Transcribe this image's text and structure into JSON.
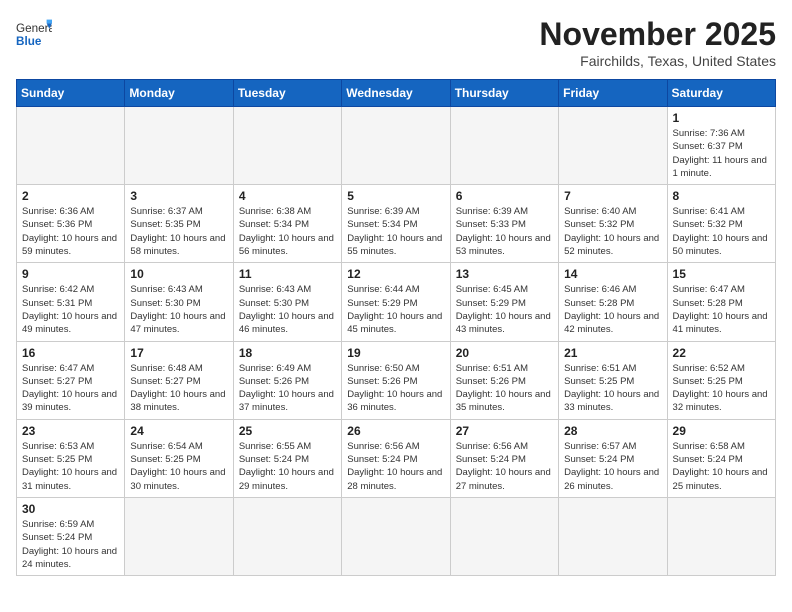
{
  "header": {
    "logo_general": "General",
    "logo_blue": "Blue",
    "month_title": "November 2025",
    "location": "Fairchilds, Texas, United States"
  },
  "days_of_week": [
    "Sunday",
    "Monday",
    "Tuesday",
    "Wednesday",
    "Thursday",
    "Friday",
    "Saturday"
  ],
  "weeks": [
    [
      {
        "day": "",
        "info": ""
      },
      {
        "day": "",
        "info": ""
      },
      {
        "day": "",
        "info": ""
      },
      {
        "day": "",
        "info": ""
      },
      {
        "day": "",
        "info": ""
      },
      {
        "day": "",
        "info": ""
      },
      {
        "day": "1",
        "info": "Sunrise: 7:36 AM\nSunset: 6:37 PM\nDaylight: 11 hours and 1 minute."
      }
    ],
    [
      {
        "day": "2",
        "info": "Sunrise: 6:36 AM\nSunset: 5:36 PM\nDaylight: 10 hours and 59 minutes."
      },
      {
        "day": "3",
        "info": "Sunrise: 6:37 AM\nSunset: 5:35 PM\nDaylight: 10 hours and 58 minutes."
      },
      {
        "day": "4",
        "info": "Sunrise: 6:38 AM\nSunset: 5:34 PM\nDaylight: 10 hours and 56 minutes."
      },
      {
        "day": "5",
        "info": "Sunrise: 6:39 AM\nSunset: 5:34 PM\nDaylight: 10 hours and 55 minutes."
      },
      {
        "day": "6",
        "info": "Sunrise: 6:39 AM\nSunset: 5:33 PM\nDaylight: 10 hours and 53 minutes."
      },
      {
        "day": "7",
        "info": "Sunrise: 6:40 AM\nSunset: 5:32 PM\nDaylight: 10 hours and 52 minutes."
      },
      {
        "day": "8",
        "info": "Sunrise: 6:41 AM\nSunset: 5:32 PM\nDaylight: 10 hours and 50 minutes."
      }
    ],
    [
      {
        "day": "9",
        "info": "Sunrise: 6:42 AM\nSunset: 5:31 PM\nDaylight: 10 hours and 49 minutes."
      },
      {
        "day": "10",
        "info": "Sunrise: 6:43 AM\nSunset: 5:30 PM\nDaylight: 10 hours and 47 minutes."
      },
      {
        "day": "11",
        "info": "Sunrise: 6:43 AM\nSunset: 5:30 PM\nDaylight: 10 hours and 46 minutes."
      },
      {
        "day": "12",
        "info": "Sunrise: 6:44 AM\nSunset: 5:29 PM\nDaylight: 10 hours and 45 minutes."
      },
      {
        "day": "13",
        "info": "Sunrise: 6:45 AM\nSunset: 5:29 PM\nDaylight: 10 hours and 43 minutes."
      },
      {
        "day": "14",
        "info": "Sunrise: 6:46 AM\nSunset: 5:28 PM\nDaylight: 10 hours and 42 minutes."
      },
      {
        "day": "15",
        "info": "Sunrise: 6:47 AM\nSunset: 5:28 PM\nDaylight: 10 hours and 41 minutes."
      }
    ],
    [
      {
        "day": "16",
        "info": "Sunrise: 6:47 AM\nSunset: 5:27 PM\nDaylight: 10 hours and 39 minutes."
      },
      {
        "day": "17",
        "info": "Sunrise: 6:48 AM\nSunset: 5:27 PM\nDaylight: 10 hours and 38 minutes."
      },
      {
        "day": "18",
        "info": "Sunrise: 6:49 AM\nSunset: 5:26 PM\nDaylight: 10 hours and 37 minutes."
      },
      {
        "day": "19",
        "info": "Sunrise: 6:50 AM\nSunset: 5:26 PM\nDaylight: 10 hours and 36 minutes."
      },
      {
        "day": "20",
        "info": "Sunrise: 6:51 AM\nSunset: 5:26 PM\nDaylight: 10 hours and 35 minutes."
      },
      {
        "day": "21",
        "info": "Sunrise: 6:51 AM\nSunset: 5:25 PM\nDaylight: 10 hours and 33 minutes."
      },
      {
        "day": "22",
        "info": "Sunrise: 6:52 AM\nSunset: 5:25 PM\nDaylight: 10 hours and 32 minutes."
      }
    ],
    [
      {
        "day": "23",
        "info": "Sunrise: 6:53 AM\nSunset: 5:25 PM\nDaylight: 10 hours and 31 minutes."
      },
      {
        "day": "24",
        "info": "Sunrise: 6:54 AM\nSunset: 5:25 PM\nDaylight: 10 hours and 30 minutes."
      },
      {
        "day": "25",
        "info": "Sunrise: 6:55 AM\nSunset: 5:24 PM\nDaylight: 10 hours and 29 minutes."
      },
      {
        "day": "26",
        "info": "Sunrise: 6:56 AM\nSunset: 5:24 PM\nDaylight: 10 hours and 28 minutes."
      },
      {
        "day": "27",
        "info": "Sunrise: 6:56 AM\nSunset: 5:24 PM\nDaylight: 10 hours and 27 minutes."
      },
      {
        "day": "28",
        "info": "Sunrise: 6:57 AM\nSunset: 5:24 PM\nDaylight: 10 hours and 26 minutes."
      },
      {
        "day": "29",
        "info": "Sunrise: 6:58 AM\nSunset: 5:24 PM\nDaylight: 10 hours and 25 minutes."
      }
    ],
    [
      {
        "day": "30",
        "info": "Sunrise: 6:59 AM\nSunset: 5:24 PM\nDaylight: 10 hours and 24 minutes."
      },
      {
        "day": "",
        "info": ""
      },
      {
        "day": "",
        "info": ""
      },
      {
        "day": "",
        "info": ""
      },
      {
        "day": "",
        "info": ""
      },
      {
        "day": "",
        "info": ""
      },
      {
        "day": "",
        "info": ""
      }
    ]
  ]
}
